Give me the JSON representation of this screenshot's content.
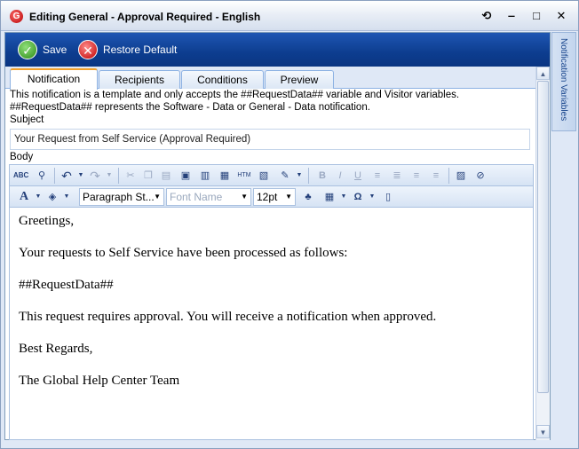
{
  "window": {
    "title": "Editing General - Approval Required - English",
    "controls": {
      "refresh": "⟲",
      "minimize": "‒",
      "maximize": "□",
      "close": "✕"
    }
  },
  "actions": {
    "save": "Save",
    "restore": "Restore Default"
  },
  "tabs": [
    {
      "label": "Notification",
      "active": true
    },
    {
      "label": "Recipients",
      "active": false
    },
    {
      "label": "Conditions",
      "active": false
    },
    {
      "label": "Preview",
      "active": false
    }
  ],
  "notification": {
    "note_line1": "This notification is a template and only accepts the ##RequestData## variable and Visitor variables.",
    "note_line2": "##RequestData## represents the Software - Data or General - Data notification.",
    "subject_label": "Subject",
    "subject_value": "Your Request from Self Service (Approval Required)",
    "body_label": "Body"
  },
  "editor": {
    "paragraph_style": "Paragraph St...",
    "font_name_placeholder": "Font Name",
    "font_size": "12pt",
    "body_paragraphs": [
      "Greetings,",
      "Your requests to Self Service have been processed as follows:",
      "##RequestData##",
      "This request requires approval. You will receive a notification when approved.",
      "Best Regards,",
      "The Global Help Center Team"
    ]
  },
  "side_panel": {
    "label": "Notification Variables"
  },
  "colors": {
    "action_bar": "#0d3d8f",
    "active_tab_accent": "#f2a12c",
    "window_bg": "#dfe8f6"
  }
}
